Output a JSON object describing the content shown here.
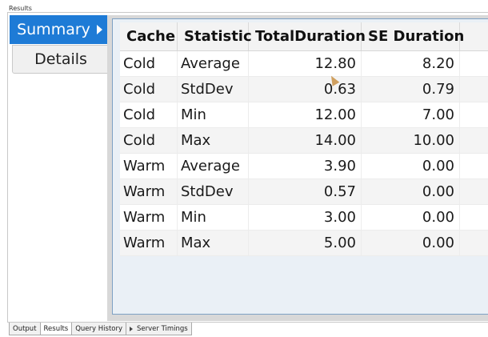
{
  "panel": {
    "title": "Results"
  },
  "side_tabs": [
    {
      "label": "Summary",
      "active": true
    },
    {
      "label": "Details",
      "active": false
    }
  ],
  "table": {
    "columns": [
      "Cache",
      "Statistic",
      "TotalDuration",
      "SE Duration",
      ""
    ],
    "rows": [
      {
        "cache": "Cold",
        "statistic": "Average",
        "total": "12.80",
        "se": "8.20"
      },
      {
        "cache": "Cold",
        "statistic": "StdDev",
        "total": "0.63",
        "se": "0.79"
      },
      {
        "cache": "Cold",
        "statistic": "Min",
        "total": "12.00",
        "se": "7.00"
      },
      {
        "cache": "Cold",
        "statistic": "Max",
        "total": "14.00",
        "se": "10.00"
      },
      {
        "cache": "Warm",
        "statistic": "Average",
        "total": "3.90",
        "se": "0.00"
      },
      {
        "cache": "Warm",
        "statistic": "StdDev",
        "total": "0.57",
        "se": "0.00"
      },
      {
        "cache": "Warm",
        "statistic": "Min",
        "total": "3.00",
        "se": "0.00"
      },
      {
        "cache": "Warm",
        "statistic": "Max",
        "total": "5.00",
        "se": "0.00"
      }
    ]
  },
  "bottom_tabs": [
    {
      "label": "Output",
      "active": false
    },
    {
      "label": "Results",
      "active": true
    },
    {
      "label": "Query History",
      "active": false
    },
    {
      "label": "Server Timings",
      "active": false,
      "icon": "play-triangle-icon"
    }
  ],
  "colors": {
    "accent": "#1e7bd6",
    "grid_border": "#7ea1c4"
  }
}
